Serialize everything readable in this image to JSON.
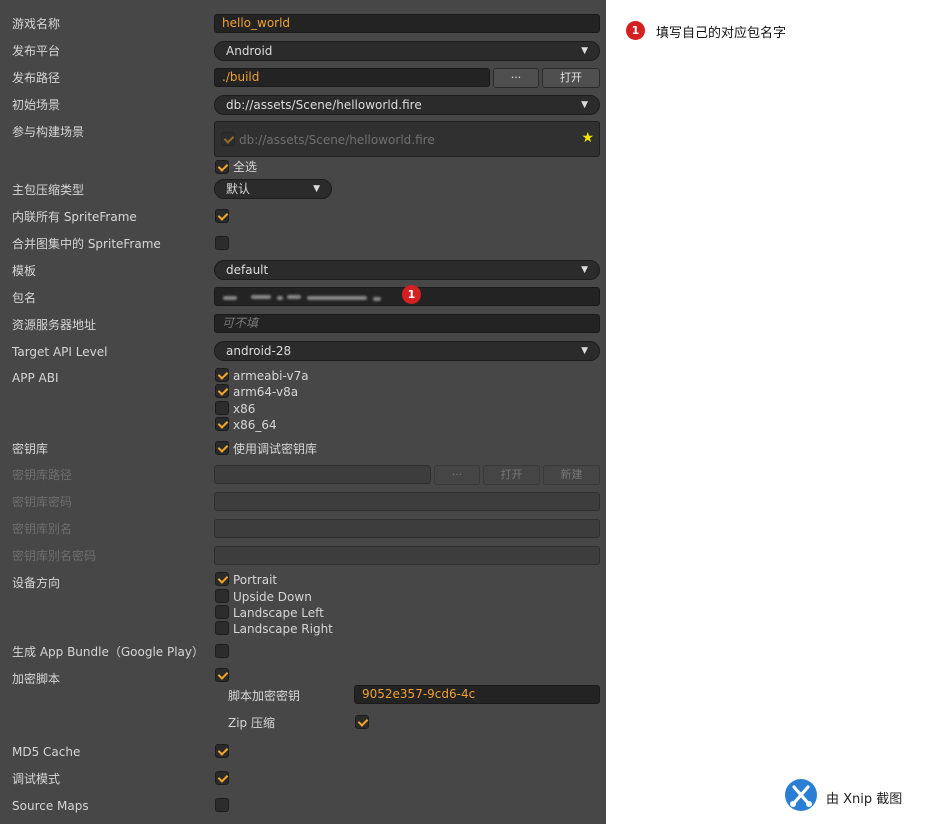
{
  "labels": {
    "game_name": "游戏名称",
    "platform": "发布平台",
    "build_path": "发布路径",
    "start_scene": "初始场景",
    "included_scenes": "参与构建场景",
    "compress_type": "主包压缩类型",
    "inline_sprite": "内联所有 SpriteFrame",
    "merge_sprite": "合并图集中的 SpriteFrame",
    "template": "模板",
    "package_name": "包名",
    "resource_server": "资源服务器地址",
    "target_api": "Target API Level",
    "app_abi": "APP ABI",
    "keystore": "密钥库",
    "keystore_path": "密钥库路径",
    "keystore_password": "密钥库密码",
    "keystore_alias": "密钥库别名",
    "keystore_alias_password": "密钥库别名密码",
    "orientation": "设备方向",
    "app_bundle": "生成 App Bundle（Google Play）",
    "encrypt_js": "加密脚本",
    "script_key": "脚本加密密钥",
    "zip_compress": "Zip 压缩",
    "md5_cache": "MD5 Cache",
    "debug_mode": "调试模式",
    "source_maps": "Source Maps"
  },
  "values": {
    "game_name": "hello_world",
    "platform": "Android",
    "build_path": "./build",
    "browse_button": "···",
    "open_button": "打开",
    "start_scene": "db://assets/Scene/helloworld.fire",
    "scene_item": "db://assets/Scene/helloworld.fire",
    "select_all": "全选",
    "compress_type": "默认",
    "template": "default",
    "resource_server_placeholder": "可不填",
    "target_api": "android-28",
    "abi_options": [
      "armeabi-v7a",
      "arm64-v8a",
      "x86",
      "x86_64"
    ],
    "use_debug_keystore": "使用调试密钥库",
    "keystore_browse": "···",
    "keystore_open": "打开",
    "keystore_new": "新建",
    "orientations": [
      "Portrait",
      "Upside Down",
      "Landscape Left",
      "Landscape Right"
    ],
    "script_key": "9052e357-9cd6-4c"
  },
  "annotation": {
    "badge": "1",
    "note": "填写自己的对应包名字"
  },
  "watermark": "由 Xnip 截图",
  "colors": {
    "accent": "#f5a623",
    "badge": "#d42020",
    "panel": "#474747"
  }
}
